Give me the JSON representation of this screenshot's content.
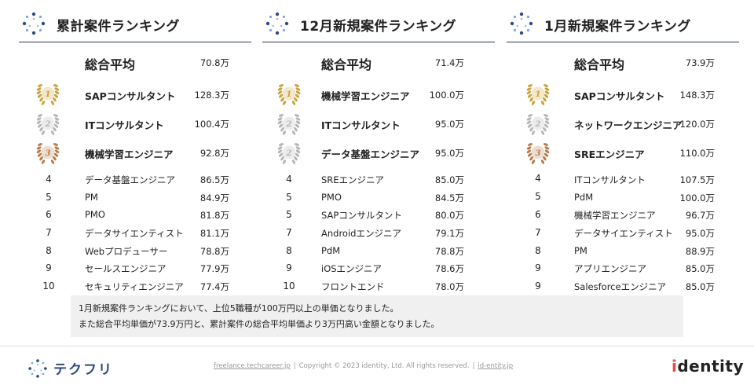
{
  "columns": [
    {
      "title": "累計案件ランキング",
      "average": {
        "label": "総合平均",
        "value": "70.8万"
      },
      "rows": [
        {
          "rank": "1",
          "name": "SAPコンサルタント",
          "value": "128.3万"
        },
        {
          "rank": "2",
          "name": "ITコンサルタント",
          "value": "100.4万"
        },
        {
          "rank": "3",
          "name": "機械学習エンジニア",
          "value": "92.8万"
        },
        {
          "rank": "4",
          "name": "データ基盤エンジニア",
          "value": "86.5万"
        },
        {
          "rank": "5",
          "name": "PM",
          "value": "84.9万"
        },
        {
          "rank": "6",
          "name": "PMO",
          "value": "81.8万"
        },
        {
          "rank": "7",
          "name": "データサイエンティスト",
          "value": "81.1万"
        },
        {
          "rank": "8",
          "name": "Webプロデューサー",
          "value": "78.8万"
        },
        {
          "rank": "9",
          "name": "セールスエンジニア",
          "value": "77.9万"
        },
        {
          "rank": "10",
          "name": "セキュリティエンジニア",
          "value": "77.4万"
        }
      ]
    },
    {
      "title": "12月新規案件ランキング",
      "average": {
        "label": "総合平均",
        "value": "71.4万"
      },
      "rows": [
        {
          "rank": "1",
          "name": "機械学習エンジニア",
          "value": "100.0万"
        },
        {
          "rank": "2",
          "name": "ITコンサルタント",
          "value": "95.0万"
        },
        {
          "rank": "2",
          "name": "データ基盤エンジニア",
          "value": "95.0万"
        },
        {
          "rank": "4",
          "name": "SREエンジニア",
          "value": "85.0万"
        },
        {
          "rank": "5",
          "name": "PMO",
          "value": "84.5万"
        },
        {
          "rank": "5",
          "name": "SAPコンサルタント",
          "value": "80.0万"
        },
        {
          "rank": "7",
          "name": "Androidエンジニア",
          "value": "79.1万"
        },
        {
          "rank": "8",
          "name": "PdM",
          "value": "78.8万"
        },
        {
          "rank": "9",
          "name": "iOSエンジニア",
          "value": "78.6万"
        },
        {
          "rank": "10",
          "name": "フロントエンド",
          "value": "78.0万"
        }
      ]
    },
    {
      "title": "1月新規案件ランキング",
      "average": {
        "label": "総合平均",
        "value": "73.9万"
      },
      "rows": [
        {
          "rank": "1",
          "name": "SAPコンサルタント",
          "value": "148.3万"
        },
        {
          "rank": "2",
          "name": "ネットワークエンジニア",
          "value": "120.0万"
        },
        {
          "rank": "3",
          "name": "SREエンジニア",
          "value": "110.0万"
        },
        {
          "rank": "4",
          "name": "ITコンサルタント",
          "value": "107.5万"
        },
        {
          "rank": "5",
          "name": "PdM",
          "value": "100.0万"
        },
        {
          "rank": "6",
          "name": "機械学習エンジニア",
          "value": "96.7万"
        },
        {
          "rank": "7",
          "name": "データサイエンティスト",
          "value": "95.0万"
        },
        {
          "rank": "8",
          "name": "PM",
          "value": "88.9万"
        },
        {
          "rank": "9",
          "name": "アプリエンジニア",
          "value": "85.0万"
        },
        {
          "rank": "9",
          "name": "Salesforceエンジニア",
          "value": "85.0万"
        }
      ]
    }
  ],
  "summary": {
    "line1": "1月新規案件ランキングにおいて、上位5職種が100万円以上の単価となりました。",
    "line2": "また総合平均単価が73.9万円と、累計案件の総合平均単価より3万円高い金額となりました。"
  },
  "footer": {
    "brand": "テクフリ",
    "link1": "freelance.techcareer.jp",
    "copyright": "Copyright © 2023 identity, Ltd. All rights reserved.",
    "link2": "id-entity.jp",
    "separator": "|",
    "company_logo_text": "identity"
  },
  "colors": {
    "gold": "#c9a23a",
    "silver": "#b5b5b5",
    "bronze": "#b87a4b",
    "header_rule": "#2b3a55",
    "brand_blue": "#2f4a80",
    "accent_red": "#e84a4a"
  },
  "icons": [
    "dotted-circle-logo-icon",
    "gold-medal-icon",
    "silver-medal-icon",
    "bronze-medal-icon",
    "identity-logo"
  ]
}
